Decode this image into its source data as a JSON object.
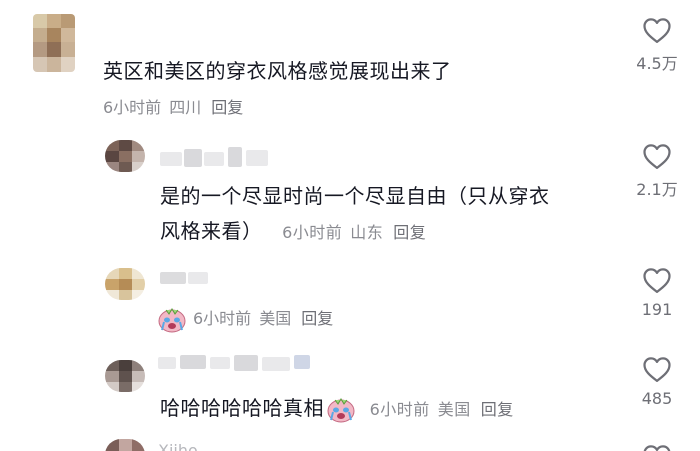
{
  "comments": [
    {
      "text": "英区和美区的穿衣风格感觉展现出来了",
      "time": "6小时前",
      "region": "四川",
      "reply": "回复",
      "likes": "4.5万"
    },
    {
      "text_line1": "是的一个尽显时尚一个尽显自由（只从穿衣",
      "text_line2": "风格来看）",
      "time": "6小时前",
      "region": "山东",
      "reply": "回复",
      "likes": "2.1万"
    },
    {
      "time": "6小时前",
      "region": "美国",
      "reply": "回复",
      "likes": "191",
      "emoji": "crying-face-emoji"
    },
    {
      "text": "哈哈哈哈哈哈真相",
      "time": "6小时前",
      "region": "美国",
      "reply": "回复",
      "likes": "485",
      "emoji": "crying-face-emoji"
    },
    {
      "username_partial": "Xiiho"
    }
  ],
  "icons": {
    "like": "heart-outline-icon"
  },
  "colors": {
    "text": "#161823",
    "meta": "#8a8b91",
    "reply": "#6e6f76"
  }
}
